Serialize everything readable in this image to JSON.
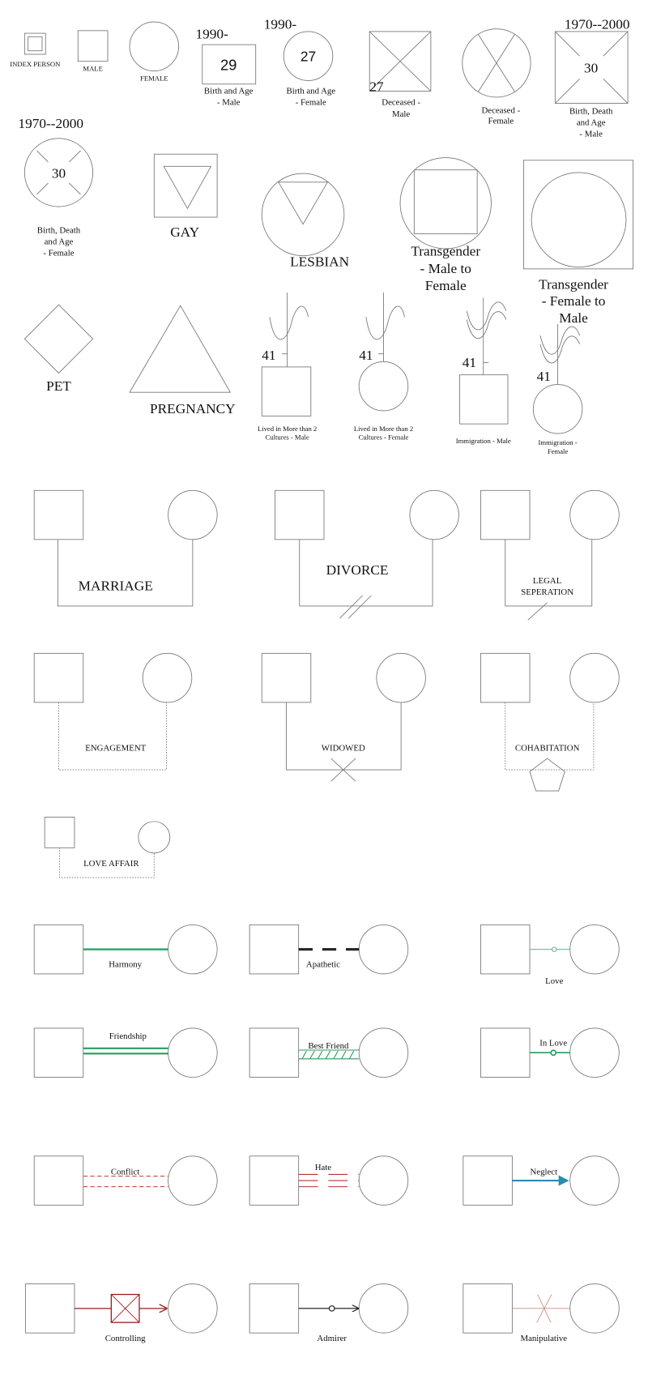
{
  "colors": {
    "harmony": "#3aaa73",
    "friendship": "#2a9a60",
    "love": "#5cbf95",
    "conflict": "#c0392b",
    "hate": "#b83232",
    "neglect": "#2a8cb0",
    "controlling": "#9b1c1c",
    "manipulative": "#d08a80",
    "apathetic": "#222222",
    "cohabitation": "#d49a70"
  },
  "symbols": {
    "index_person": "INDEX PERSON",
    "male": "MALE",
    "female": "FEMALE",
    "birth_male": {
      "year": "1990-",
      "age": "29",
      "l1": "Birth and Age",
      "l2": "- Male"
    },
    "birth_female": {
      "year": "1990-",
      "age": "27",
      "l1": "Birth and Age",
      "l2": "- Female"
    },
    "deceased_male": {
      "age": "27",
      "l1": "Deceased -",
      "l2": "Male"
    },
    "deceased_female": {
      "l1": "Deceased -",
      "l2": "Female"
    },
    "bda_male": {
      "years": "1970--2000",
      "age": "30",
      "l1": "Birth, Death",
      "l2": "and Age",
      "l3": "- Male"
    },
    "bda_female": {
      "years": "1970--2000",
      "age": "30",
      "l1": "Birth, Death",
      "l2": "and Age",
      "l3": "- Female"
    },
    "gay": "GAY",
    "lesbian": "LESBIAN",
    "trans_mf": {
      "l1": "Transgender",
      "l2": "- Male to",
      "l3": "Female"
    },
    "trans_fm": {
      "l1": "Transgender",
      "l2": "- Female to",
      "l3": "Male"
    },
    "pet": "PET",
    "pregnancy": "PREGNANCY",
    "cultures_male": {
      "age": "41",
      "l1": "Lived in More than 2",
      "l2": "Cultures - Male"
    },
    "cultures_female": {
      "age": "41",
      "l1": "Lived in More than 2",
      "l2": "Cultures - Female"
    },
    "immigration_male": {
      "age": "41",
      "l1": "Immigration - Male"
    },
    "immigration_female": {
      "age": "41",
      "l1": "Immigration -",
      "l2": "Female"
    }
  },
  "family": {
    "marriage": "MARRIAGE",
    "divorce": "DIVORCE",
    "sep1": "LEGAL",
    "sep2": "SEPERATION",
    "engagement": "ENGAGEMENT",
    "widowed": "WIDOWED",
    "cohabitation": "COHABITATION",
    "love_affair": "LOVE AFFAIR"
  },
  "emotional": {
    "harmony": "Harmony",
    "apathetic": "Apathetic",
    "love": "Love",
    "friendship": "Friendship",
    "best_friend": "Best Friend",
    "in_love": "In Love",
    "conflict": "Conflict",
    "hate": "Hate",
    "neglect": "Neglect",
    "controlling": "Controlling",
    "admirer": "Admirer",
    "manipulative": "Manipulative"
  }
}
